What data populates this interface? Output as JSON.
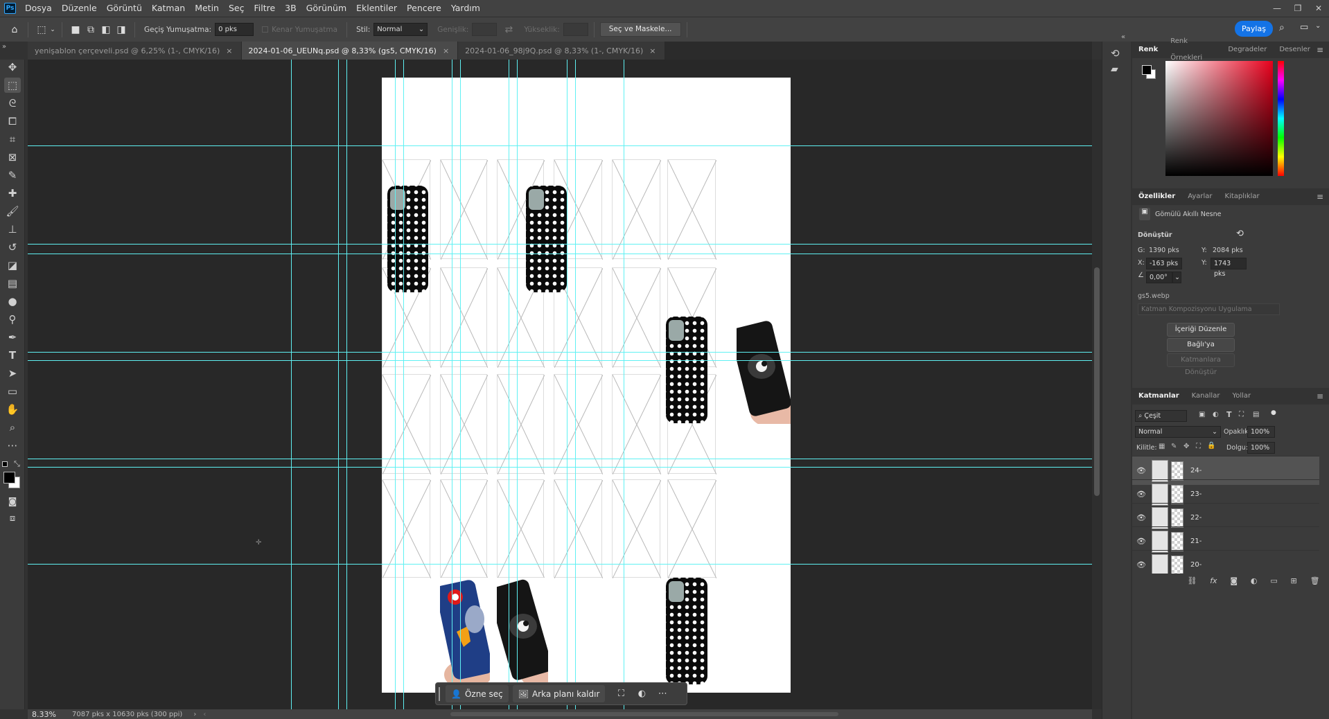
{
  "app_logo": "Ps",
  "menu": [
    "Dosya",
    "Düzenle",
    "Görüntü",
    "Katman",
    "Metin",
    "Seç",
    "Filtre",
    "3B",
    "Görünüm",
    "Eklentiler",
    "Pencere",
    "Yardım"
  ],
  "window_controls": [
    "—",
    "❐",
    "✕"
  ],
  "options": {
    "feather_label": "Geçiş Yumuşatma:",
    "feather_value": "0 pks",
    "anti_alias_label": "Kenar Yumuşatma",
    "style_label": "Stil:",
    "style_value": "Normal",
    "width_label": "Genişlik:",
    "height_label": "Yükseklik:",
    "select_mask_label": "Seç ve Maskele...",
    "share_label": "Paylaş"
  },
  "tabs": [
    {
      "label": "yenişablon çerçeveli.psd @ 6,25% (1-, CMYK/16)",
      "active": false
    },
    {
      "label": "2024-01-06_UEUNq.psd @ 8,33% (gs5, CMYK/16)",
      "active": true
    },
    {
      "label": "2024-01-06_98j9Q.psd @ 8,33% (1-, CMYK/16)",
      "active": false
    }
  ],
  "tools": [
    "move-icon",
    "marquee-icon",
    "lasso-icon",
    "object-select-icon",
    "crop-icon",
    "frame-icon",
    "eyedropper-icon",
    "healing-icon",
    "brush-icon",
    "stamp-icon",
    "history-brush-icon",
    "eraser-icon",
    "gradient-icon",
    "blur-icon",
    "dodge-icon",
    "pen-icon",
    "type-icon",
    "path-select-icon",
    "shape-icon",
    "hand-icon",
    "zoom-icon",
    "more-tools-icon"
  ],
  "floatbar": {
    "subject_label": "Özne seç",
    "remove_bg_label": "Arka planı kaldır"
  },
  "status": {
    "zoom": "8.33%",
    "doc_size": "7087 pks x 10630 pks (300 ppi)"
  },
  "color_panel": {
    "tabs": [
      "Renk",
      "Renk Örnekleri",
      "Degradeler",
      "Desenler"
    ],
    "foreground": "#000000",
    "background": "#ffffff"
  },
  "properties": {
    "tabs": [
      "Özellikler",
      "Ayarlar",
      "Kitaplıklar"
    ],
    "object_type": "Gömülü Akıllı Nesne",
    "transform_label": "Dönüştür",
    "w_label": "G:",
    "w_value": "1390 pks",
    "h_label": "Y:",
    "h_value": "2084 pks",
    "x_label": "X:",
    "x_value": "-163 pks",
    "y_label": "Y:",
    "y_value": "1743 pks",
    "angle_value": "0,00°",
    "filename": "gs5.webp",
    "comp_placeholder": "Katman Kompozisyonu Uygulama",
    "edit_contents_label": "İçeriği Düzenle",
    "convert_linked_label": "Bağlı'ya Dönüştür...",
    "convert_layers_label": "Katmanlara Dönüştür"
  },
  "layers_panel": {
    "tabs": [
      "Katmanlar",
      "Kanallar",
      "Yollar"
    ],
    "filter_label": "Çeşit",
    "blend_mode": "Normal",
    "opacity_label": "Opaklık:",
    "opacity_value": "100%",
    "lock_label": "Kilitle:",
    "fill_label": "Dolgu:",
    "fill_value": "100%",
    "layers": [
      {
        "name": "24-",
        "selected": true
      },
      {
        "name": "23-",
        "selected": false
      },
      {
        "name": "22-",
        "selected": false
      },
      {
        "name": "21-",
        "selected": false
      },
      {
        "name": "20-",
        "selected": false
      }
    ]
  }
}
